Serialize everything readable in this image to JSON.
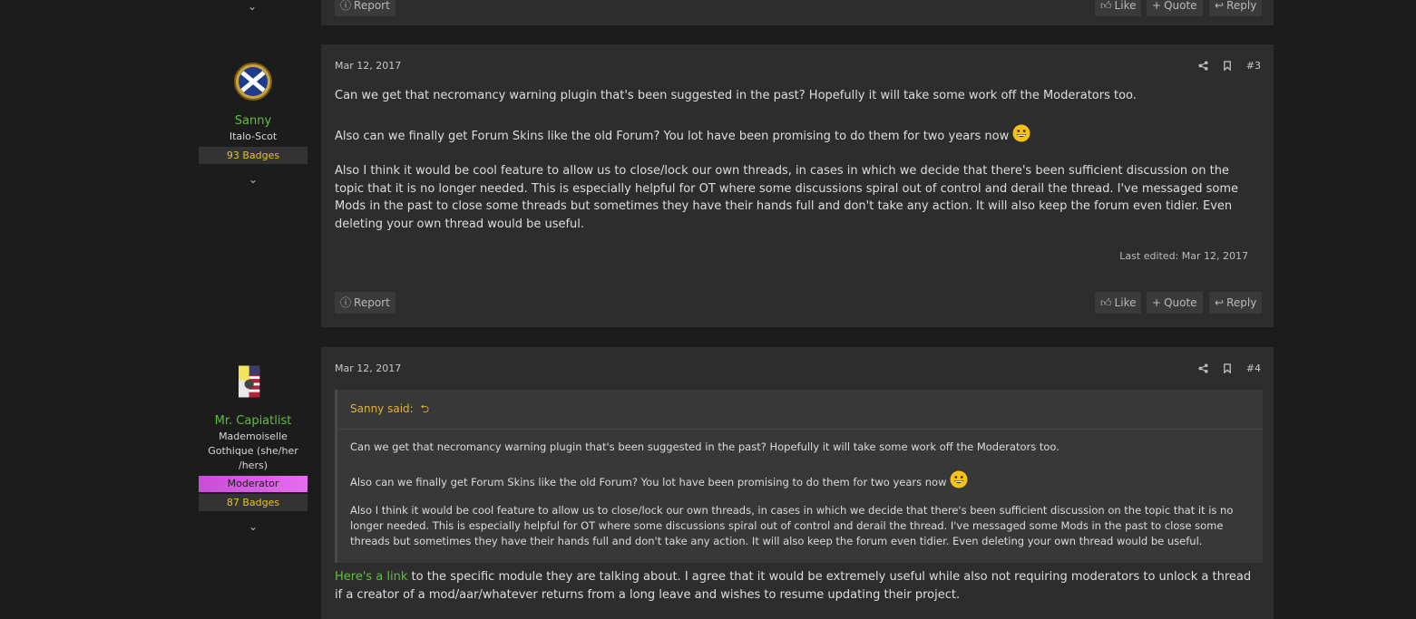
{
  "top_fragment": {
    "report": "Report",
    "like": "Like",
    "quote": "Quote",
    "reply": "Reply"
  },
  "posts": [
    {
      "user": {
        "name": "Sanny",
        "title": "Italo-Scot",
        "badges": "93 Badges"
      },
      "date": "Mar 12, 2017",
      "number": "#3",
      "paragraphs": [
        "Can we get that necromancy warning plugin that's been suggested in the past? Hopefully it will take some work off the Moderators too.",
        "Also can we finally get Forum Skins like the old Forum? You lot have been promising to do them for two years now",
        "Also I think it would be cool feature to allow us to close/lock our own threads, in cases in which we decide that there's been sufficient discussion on the topic that it is no longer needed. This is especially helpful for OT where some discussions spiral out of control and derail the thread. I've messaged some Mods in the past to close some threads but sometimes they have their hands full and don't take any action. It will also keep the forum even tidier. Even deleting your own thread would be useful."
      ],
      "last_edited": "Last edited: Mar 12, 2017",
      "actions": {
        "report": "Report",
        "like": "Like",
        "quote": "Quote",
        "reply": "Reply"
      }
    },
    {
      "user": {
        "name": "Mr. Capiatlist",
        "title_lines": [
          "Mademoiselle",
          "Gothique (she/her",
          "/hers)"
        ],
        "role": "Moderator",
        "badges": "87 Badges"
      },
      "date": "Mar 12, 2017",
      "number": "#4",
      "quote": {
        "author": "Sanny said:",
        "paragraphs": [
          "Can we get that necromancy warning plugin that's been suggested in the past? Hopefully it will take some work off the Moderators too.",
          "Also can we finally get Forum Skins like the old Forum? You lot have been promising to do them for two years now",
          "Also I think it would be cool feature to allow us to close/lock our own threads, in cases in which we decide that there's been sufficient discussion on the topic that it is no longer needed. This is especially helpful for OT where some discussions spiral out of control and derail the thread. I've messaged some Mods in the past to close some threads but sometimes they have their hands full and don't take any action. It will also keep the forum even tidier. Even deleting your own thread would be useful."
        ]
      },
      "reply_link": "Here's a link",
      "reply_text": " to the specific module they are talking about. I agree that it would be extremely useful while also not requiring moderators to unlock a thread if a creator of a mod/aar/whatever returns from a long leave and wishes to resume updating their project."
    }
  ]
}
